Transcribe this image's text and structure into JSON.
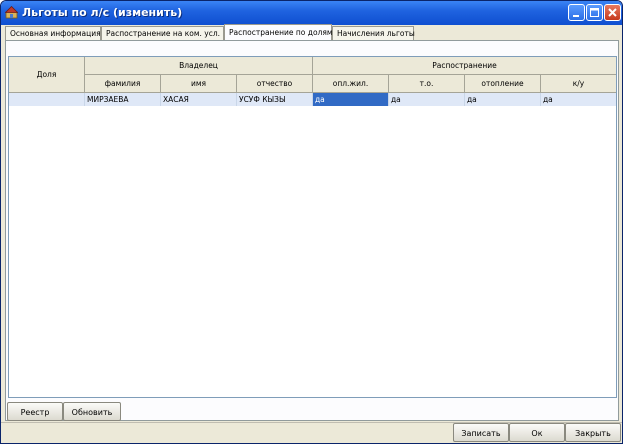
{
  "window": {
    "title": "Льготы по л/с (изменить)"
  },
  "tabs": [
    {
      "label": "Основная информация",
      "active": false
    },
    {
      "label": "Распостранение на ком. усл.",
      "active": false
    },
    {
      "label": "Распостранение по долям",
      "active": true
    },
    {
      "label": "Начисления льготы",
      "active": false
    }
  ],
  "grid": {
    "col_dolya": "Доля",
    "group_owner": "Владелец",
    "group_spread": "Распостранение",
    "owner_cols": [
      "фамилия",
      "имя",
      "отчество"
    ],
    "spread_cols": [
      "опл.жил.",
      "т.о.",
      "отопление",
      "к/у"
    ],
    "rows": [
      {
        "dolya": "",
        "familia": "МИРЗАЕВА",
        "imya": "ХАСАЯ",
        "otchestvo": "УСУФ КЫЗЫ",
        "opl_zhil": "да",
        "to": "да",
        "otoplenie": "да",
        "ku": "да"
      }
    ]
  },
  "bottom": {
    "reestr": "Реестр",
    "obnovit": "Обновить"
  },
  "footer": {
    "zapisat": "Записать",
    "ok": "Ок",
    "zakryt": "Закрыть"
  },
  "colors": {
    "title_bar": "#1f63e0",
    "selection": "#316ac5",
    "row_bg": "#dfe8f7",
    "close_button": "#c63a1d"
  }
}
